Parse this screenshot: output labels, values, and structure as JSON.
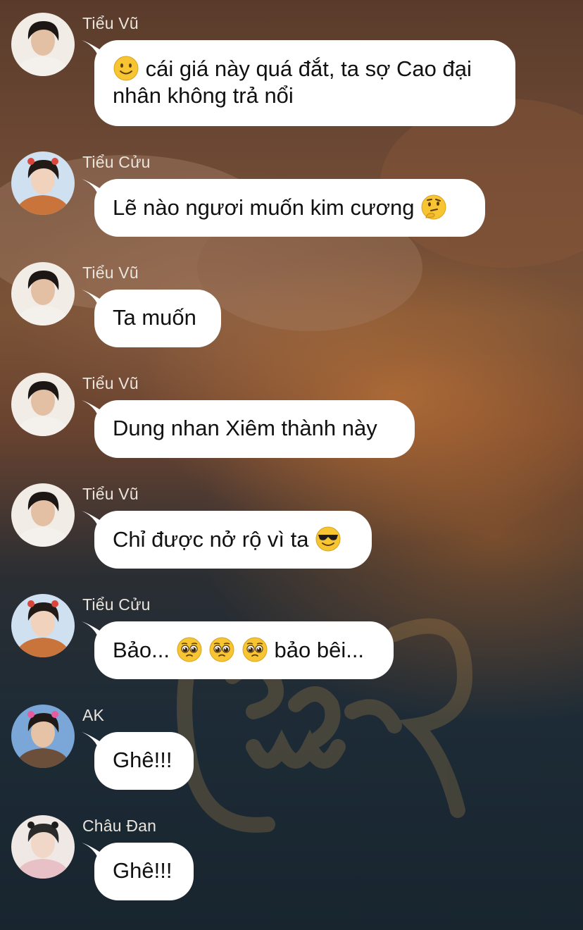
{
  "messages": [
    {
      "sender": "Tiểu Vũ",
      "avatar": "avatar-tieu-vu",
      "segments": [
        {
          "icon": "slightly-smiling-face-icon"
        },
        {
          "text": "cái giá này quá đắt, ta sợ Cao đại nhân không trả nổi"
        }
      ]
    },
    {
      "sender": "Tiểu Cửu",
      "avatar": "avatar-tieu-cuu",
      "segments": [
        {
          "text": "Lẽ nào ngươi muốn kim cương"
        },
        {
          "icon": "thinking-face-icon"
        }
      ]
    },
    {
      "sender": "Tiểu Vũ",
      "avatar": "avatar-tieu-vu",
      "segments": [
        {
          "text": "Ta muốn"
        }
      ]
    },
    {
      "sender": "Tiểu Vũ",
      "avatar": "avatar-tieu-vu",
      "segments": [
        {
          "text": "Dung nhan Xiêm thành này"
        }
      ]
    },
    {
      "sender": "Tiểu Vũ",
      "avatar": "avatar-tieu-vu",
      "segments": [
        {
          "text": "Chỉ được nở rộ vì ta"
        },
        {
          "icon": "smiling-face-with-sunglasses-icon"
        }
      ]
    },
    {
      "sender": "Tiểu Cửu",
      "avatar": "avatar-tieu-cuu",
      "segments": [
        {
          "text": "Bảo..."
        },
        {
          "icon": "pleading-face-icon"
        },
        {
          "icon": "pleading-face-icon"
        },
        {
          "icon": "pleading-face-icon"
        },
        {
          "text": "bảo bêi..."
        }
      ]
    },
    {
      "sender": "AK",
      "avatar": "avatar-ak",
      "segments": [
        {
          "text": "Ghê!!!"
        }
      ]
    },
    {
      "sender": "Châu Đan",
      "avatar": "avatar-chau-dan",
      "segments": [
        {
          "text": "Ghê!!!"
        }
      ]
    }
  ],
  "colors": {
    "bubble": "#ffffff",
    "bubble_text": "#111111",
    "sender_name": "#e9e4dc",
    "emoji_yellow": "#f7c531"
  }
}
